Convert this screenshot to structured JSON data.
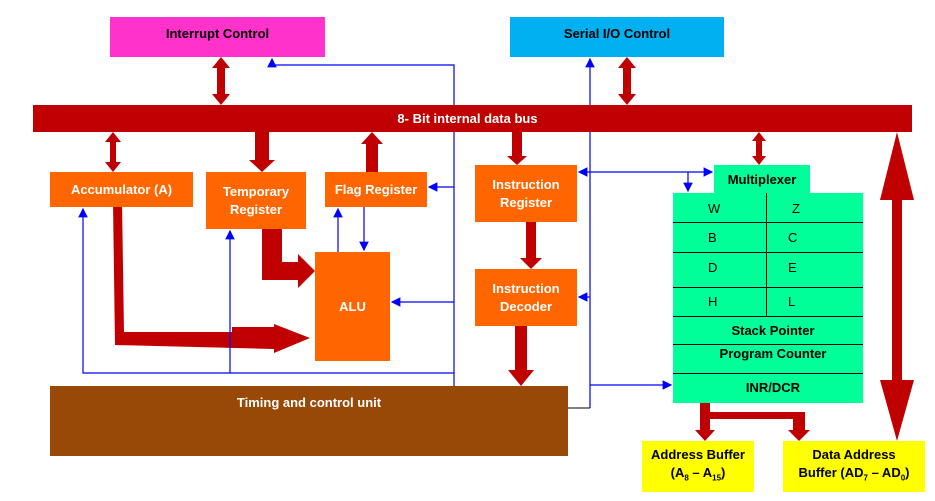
{
  "title_bus": "8- Bit internal data bus",
  "blocks": {
    "interrupt": "Interrupt Control",
    "serial": "Serial I/O Control",
    "accumulator": "Accumulator (A)",
    "temporary": "Temporary Register",
    "flag": "Flag Register",
    "alu": "ALU",
    "ir": "Instruction Register",
    "decoder": "Instruction Decoder",
    "timing": "Timing and control unit",
    "mux": "Multiplexer",
    "sp": "Stack Pointer",
    "pc": "Program Counter",
    "inr": "INR/DCR",
    "addr_buf_1": "Address Buffer",
    "addr_buf_2a": "(A",
    "addr_buf_sub1": "8",
    "addr_buf_2b": " – A",
    "addr_buf_sub2": "15",
    "addr_buf_2c": ")",
    "data_buf_1": "Data Address",
    "data_buf_2a": "Buffer (AD",
    "data_buf_sub1": "7",
    "data_buf_2b": " – AD",
    "data_buf_sub2": "0",
    "data_buf_2c": ")"
  },
  "registers": [
    [
      "W",
      "Z"
    ],
    [
      "B",
      "C"
    ],
    [
      "D",
      "E"
    ],
    [
      "H",
      "L"
    ]
  ],
  "colors": {
    "bus": "#c00000",
    "alu_blocks": "#ff6600",
    "registers": "#00ff99",
    "buffers": "#ffff00",
    "timing": "#984807",
    "interrupt": "#ff33cc",
    "serial": "#00b0f0",
    "control_lines": "#0000ff"
  }
}
